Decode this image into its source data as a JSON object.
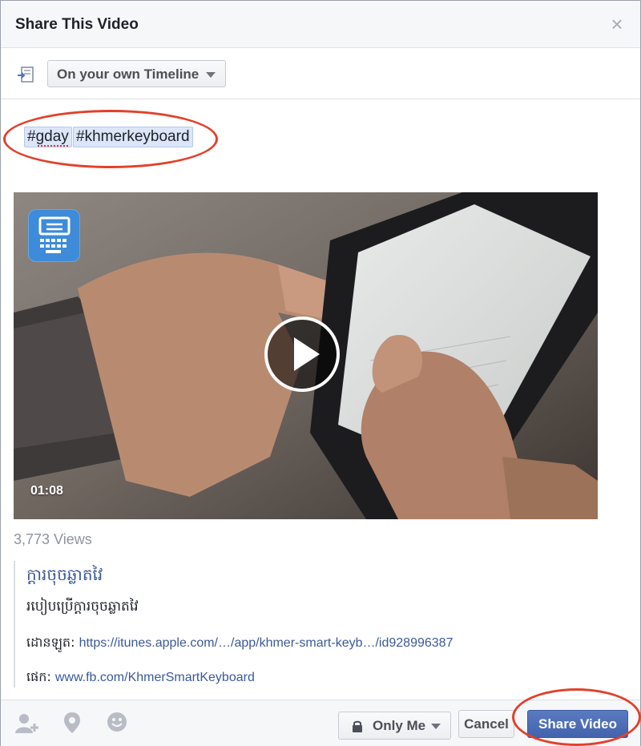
{
  "dialog": {
    "title": "Share This Video"
  },
  "share_target": {
    "selected": "On your own Timeline"
  },
  "composer": {
    "hashtags": [
      "#gday",
      "#khmerkeyboard"
    ]
  },
  "video": {
    "duration": "01:08",
    "views": "3,773 Views"
  },
  "attachment": {
    "title": "ក្តារចុចឆ្លាតវៃ",
    "description": "របៀបប្រើក្តារចុចឆ្លាតវៃ",
    "download_label": "ដោនឡូត: ",
    "download_link": "https://itunes.apple.com/…/app/khmer-smart-keyb…/id928996387",
    "page_label": "ផេក: ",
    "page_link": "www.fb.com/KhmerSmartKeyboard"
  },
  "footer": {
    "privacy_label": "Only Me",
    "cancel_label": "Cancel",
    "share_label": "Share Video"
  },
  "colors": {
    "link": "#3b5998",
    "primary_button": "#4263ad",
    "annotation": "#e2402a"
  },
  "icons": {
    "share_target": "share-destination-icon",
    "tag_people": "tag-people-icon",
    "location": "location-pin-icon",
    "feeling": "smiley-face-icon",
    "privacy": "lock-icon",
    "close": "close-icon"
  }
}
